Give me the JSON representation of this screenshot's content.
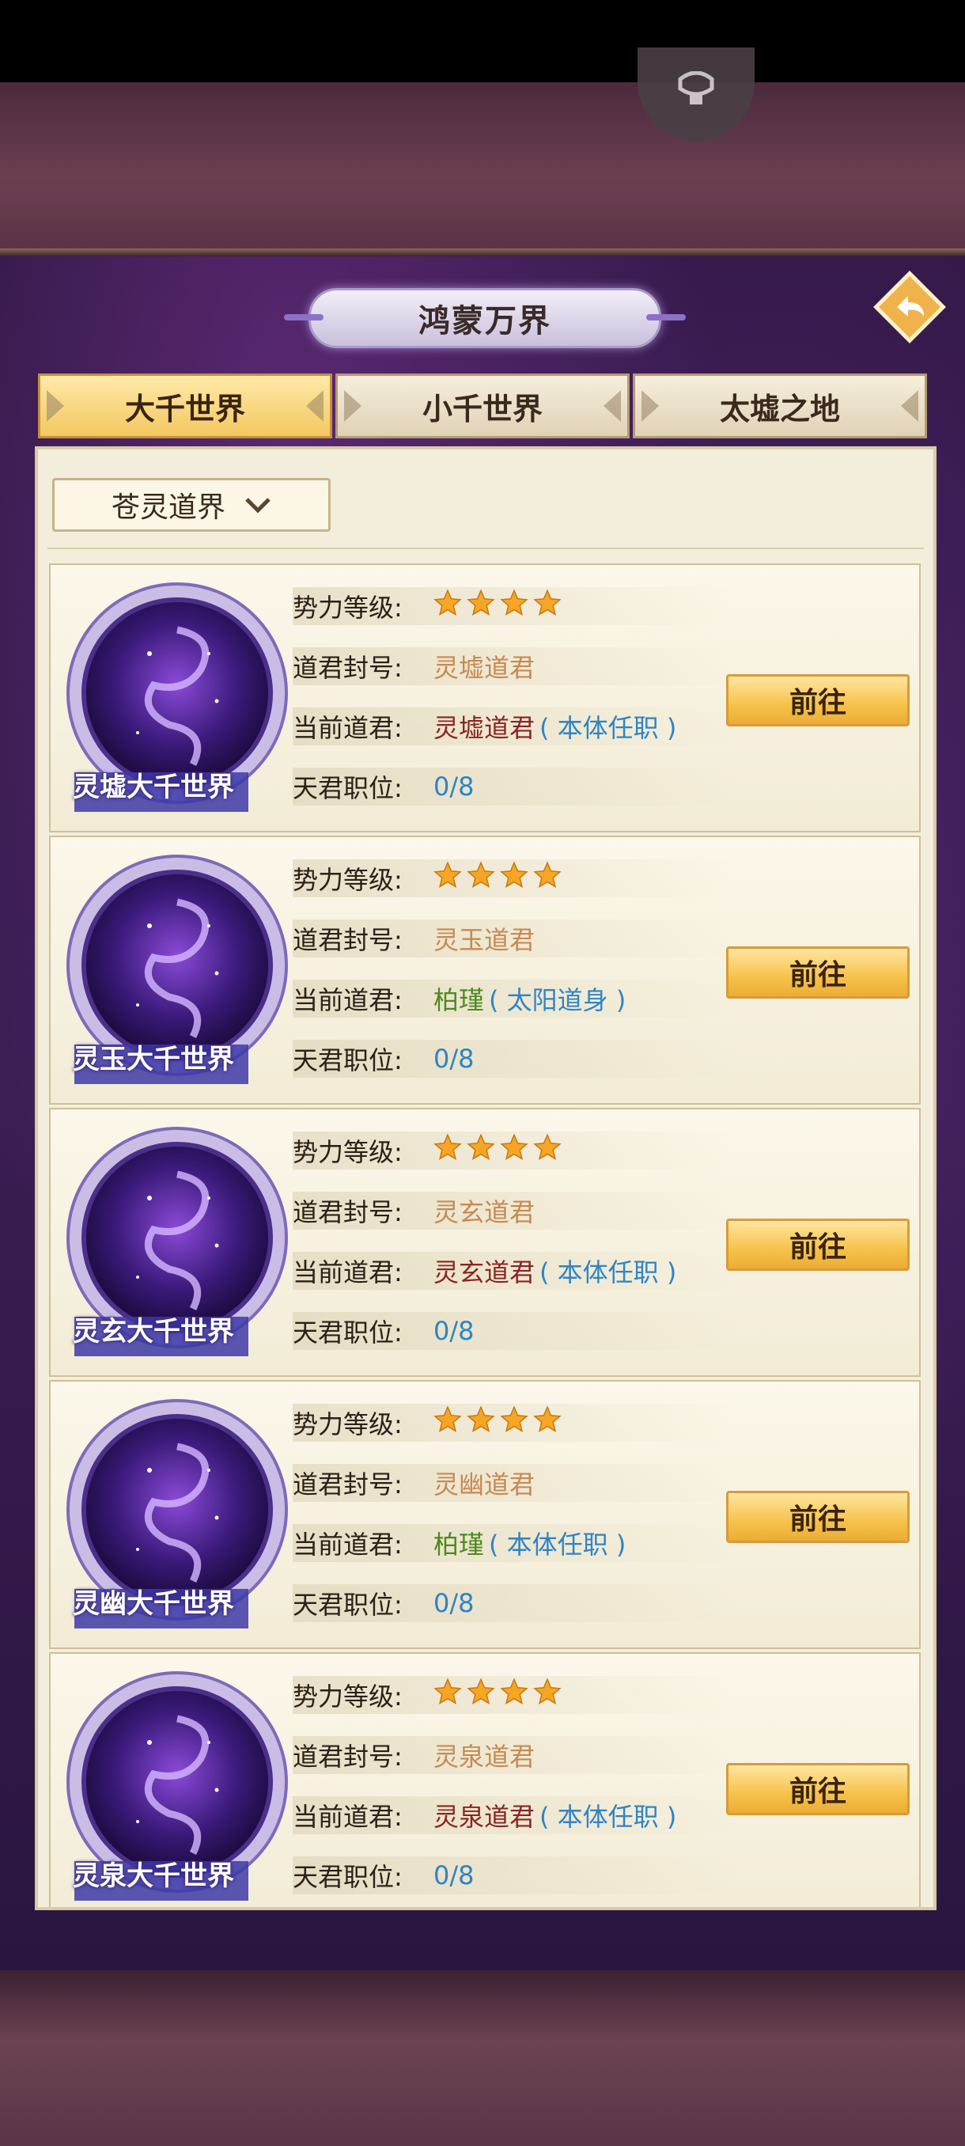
{
  "header": {
    "title": "鸿蒙万界"
  },
  "tabs": [
    {
      "label": "大千世界",
      "active": true
    },
    {
      "label": "小千世界",
      "active": false
    },
    {
      "label": "太墟之地",
      "active": false
    }
  ],
  "filter": {
    "selected": "苍灵道界"
  },
  "labels": {
    "level": "势力等级:",
    "title": "道君封号:",
    "current": "当前道君:",
    "seats": "天君职位:"
  },
  "go_label": "前往",
  "worlds": [
    {
      "name": "灵墟大千世界",
      "stars": 4,
      "title": "灵墟道君",
      "ruler": "灵墟道君",
      "ruler_note": "( 本体任职 )",
      "seats": "0/8"
    },
    {
      "name": "灵玉大千世界",
      "stars": 4,
      "title": "灵玉道君",
      "ruler": "柏瑾",
      "ruler_note": "( 太阳道身 )",
      "seats": "0/8"
    },
    {
      "name": "灵玄大千世界",
      "stars": 4,
      "title": "灵玄道君",
      "ruler": "灵玄道君",
      "ruler_note": "( 本体任职 )",
      "seats": "0/8"
    },
    {
      "name": "灵幽大千世界",
      "stars": 4,
      "title": "灵幽道君",
      "ruler": "柏瑾",
      "ruler_note": "( 本体任职 )",
      "seats": "0/8"
    },
    {
      "name": "灵泉大千世界",
      "stars": 4,
      "title": "灵泉道君",
      "ruler": "灵泉道君",
      "ruler_note": "( 本体任职 )",
      "seats": "0/8"
    }
  ],
  "colors": {
    "accent_gold": "#f3c860",
    "ruler_red": "#8a2424",
    "ruler_green": "#4d8a1e",
    "value_blue": "#2f84c4",
    "title_tan": "#c68a52"
  }
}
